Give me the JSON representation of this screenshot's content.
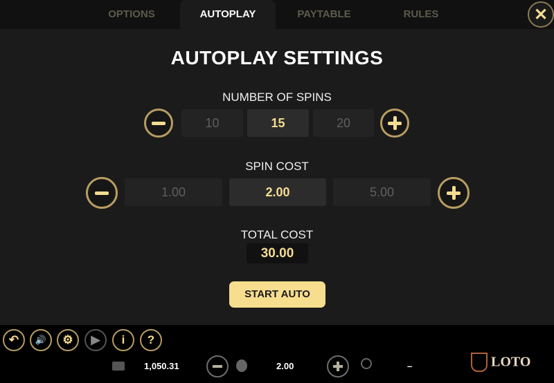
{
  "tabs": [
    {
      "label": "OPTIONS",
      "active": false
    },
    {
      "label": "AUTOPLAY",
      "active": true
    },
    {
      "label": "PAYTABLE",
      "active": false
    },
    {
      "label": "RULES",
      "active": false
    }
  ],
  "close_icon": "✕",
  "title": "AUTOPLAY SETTINGS",
  "spins": {
    "label": "NUMBER OF SPINS",
    "options": [
      "10",
      "15",
      "20"
    ],
    "selected": "15"
  },
  "spin_cost": {
    "label": "SPIN COST",
    "options": [
      "1.00",
      "2.00",
      "5.00"
    ],
    "selected": "2.00"
  },
  "total_cost": {
    "label": "TOTAL COST",
    "value": "30.00"
  },
  "start_button": "START AUTO",
  "bottom": {
    "icons": {
      "back": "↶",
      "sound": "🔊",
      "settings": "⚙",
      "autoplay": "▶",
      "info": "i",
      "help": "?"
    },
    "balance": "1,050.31",
    "bet": "2.00",
    "win": "–",
    "logo_text": "LOTO"
  }
}
